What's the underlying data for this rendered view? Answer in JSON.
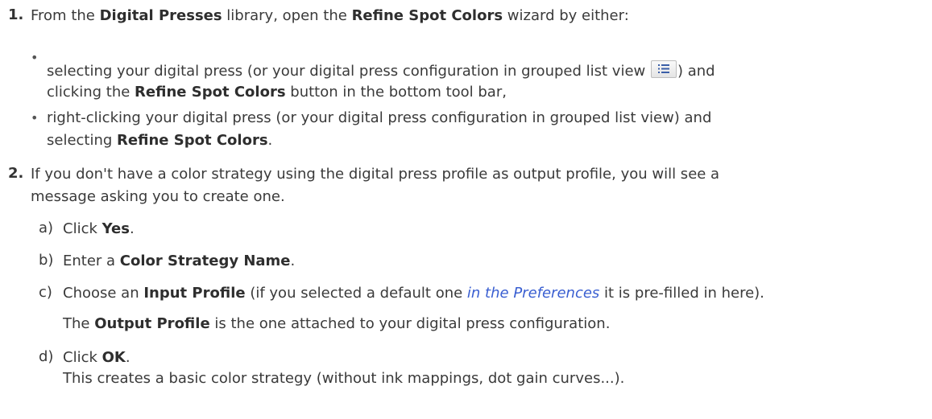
{
  "steps": [
    {
      "number": "1.",
      "intro": {
        "t1": "From the ",
        "b1": "Digital Presses",
        "t2": " library, open the ",
        "b2": "Refine Spot Colors",
        "t3": " wizard by either:"
      },
      "bullets": [
        {
          "line1": "selecting your digital press (or your digital press configuration in grouped list view ",
          "line1_end": ") and",
          "line2_t1": "clicking the ",
          "line2_b1": "Refine Spot Colors",
          "line2_t2": " button in the bottom tool bar,",
          "icon": "grouped-list-view-icon"
        },
        {
          "line1": "right-clicking your digital press (or your digital press configuration in grouped list view) and",
          "line2_t1": "selecting ",
          "line2_b1": "Refine Spot Colors",
          "line2_t2": "."
        }
      ]
    },
    {
      "number": "2.",
      "intro_line1": "If you don't have a color strategy using the digital press profile as output profile, you will see a",
      "intro_line2": "message asking you to create one.",
      "substeps": [
        {
          "label": "a)",
          "t1": "Click ",
          "b1": "Yes",
          "t2": "."
        },
        {
          "label": "b)",
          "t1": "Enter a ",
          "b1": "Color Strategy Name",
          "t2": "."
        },
        {
          "label": "c)",
          "t1": "Choose an ",
          "b1": "Input Profile",
          "t2": " (if you selected a default one ",
          "link": "in the Preferences",
          "t3": " it is pre-filled in here).",
          "note_t1": "The ",
          "note_b1": "Output Profile",
          "note_t2": " is the one attached to your digital press configuration."
        },
        {
          "label": "d)",
          "t1": "Click ",
          "b1": "OK",
          "t2": ".",
          "note": "This creates a basic color strategy (without ink mappings, dot gain curves...)."
        }
      ]
    }
  ]
}
